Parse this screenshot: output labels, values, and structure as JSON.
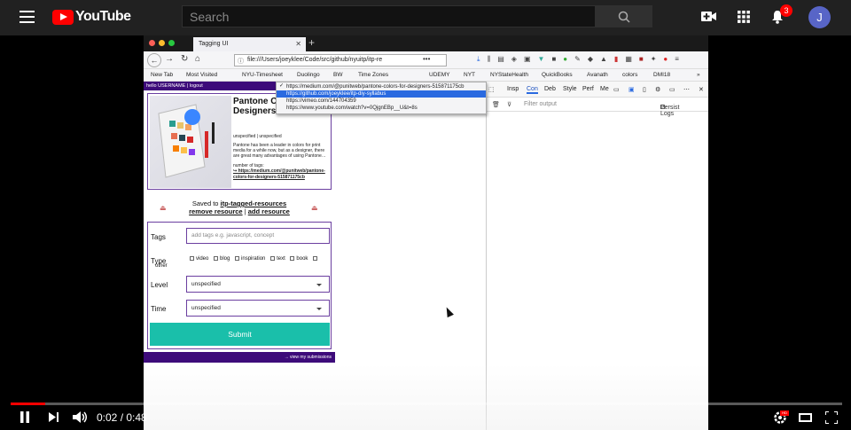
{
  "youtube": {
    "logo": "YouTube",
    "search_placeholder": "Search",
    "notification_count": "3",
    "avatar_letter": "J",
    "time": "0:02 / 0:48",
    "progress": 0.042
  },
  "browser": {
    "tab_title": "Tagging UI",
    "url": "file:///Users/joeyklee/Code/src/github/nyuitp/itp-re",
    "bookmarks": [
      "New Tab",
      "Most Visited",
      "NYU-Timesheet",
      "Duolingo",
      "BW",
      "Time Zones",
      "UDEMY",
      "NYT",
      "NYStateHealth",
      "QuickBooks",
      "Avanath",
      "colors",
      "DMI18"
    ],
    "url_dropdown": [
      "https://medium.com/@punitweb/pantone-colors-for-designers-515871175cb",
      "https://github.com/joeyklee/itp-diy-syllabus",
      "https://vimeo.com/144704359",
      "https://www.youtube.com/watch?v=0QjgnEBp__U&t=8s"
    ]
  },
  "page": {
    "userbar": "hello USERNAME | logout",
    "card": {
      "title": "Pantone Colors for Designers — Medium",
      "meta": "unspecified | unspecified",
      "description": "Pantone has been a leader in colors for print media for a while now, but as a designer, there are great many advantages of using Pantone…",
      "tags_label": "number of tags:",
      "link": "https://medium.com/@punitweb/pantone-colors-for-designers-515871175cb"
    },
    "saved": {
      "prefix": "Saved to",
      "collection": "itp-tagged-resources",
      "remove": "remove resource",
      "separator": "|",
      "add": "add resource"
    },
    "form": {
      "tags_label": "Tags",
      "tags_placeholder": "add tags e.g. javascript, concept",
      "type_label": "Type",
      "types": [
        "video",
        "blog",
        "inspiration",
        "text",
        "book",
        "other"
      ],
      "level_label": "Level",
      "level_value": "unspecified",
      "time_label": "Time",
      "time_value": "unspecified",
      "submit": "Submit"
    },
    "view_submissions": "→ view my submissions"
  },
  "devtools": {
    "tabs": [
      "Insp",
      "Con",
      "Deb",
      "Style",
      "Perf",
      "Me"
    ],
    "filter_placeholder": "Filter output",
    "persist_logs": "Persist Logs"
  }
}
